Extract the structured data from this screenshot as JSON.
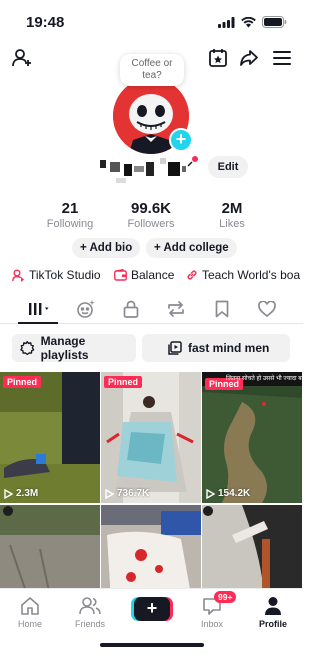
{
  "status_bar": {
    "time": "19:48"
  },
  "bubble": {
    "line1": "Coffee or",
    "line2": "tea?"
  },
  "profile": {
    "edit_label": "Edit"
  },
  "stats": [
    {
      "value": "21",
      "label": "Following"
    },
    {
      "value": "99.6K",
      "label": "Followers"
    },
    {
      "value": "2M",
      "label": "Likes"
    }
  ],
  "actions": {
    "add_bio": "+ Add bio",
    "add_college": "+ Add college"
  },
  "links": {
    "studio": "TikTok Studio",
    "balance": "Balance",
    "teach": "Teach World's boa"
  },
  "playlists": {
    "manage": "Manage playlists",
    "fast": "fast mind men"
  },
  "videos": [
    {
      "pinned": "Pinned",
      "views": "2.3M"
    },
    {
      "pinned": "Pinned",
      "views": "736.7K"
    },
    {
      "pinned": "Pinned",
      "views": "154.2K",
      "overlay_text": "जितना सोचते हो उससे भी ज्यादा बड़ी"
    },
    {
      "views": ""
    },
    {
      "views": ""
    },
    {
      "views": ""
    }
  ],
  "bottom_nav": {
    "home": "Home",
    "friends": "Friends",
    "create": "+",
    "inbox": "Inbox",
    "inbox_badge": "99+",
    "profile": "Profile"
  },
  "colors": {
    "accent": "#fe2c55",
    "cyan": "#20d5ec",
    "text": "#161823"
  }
}
